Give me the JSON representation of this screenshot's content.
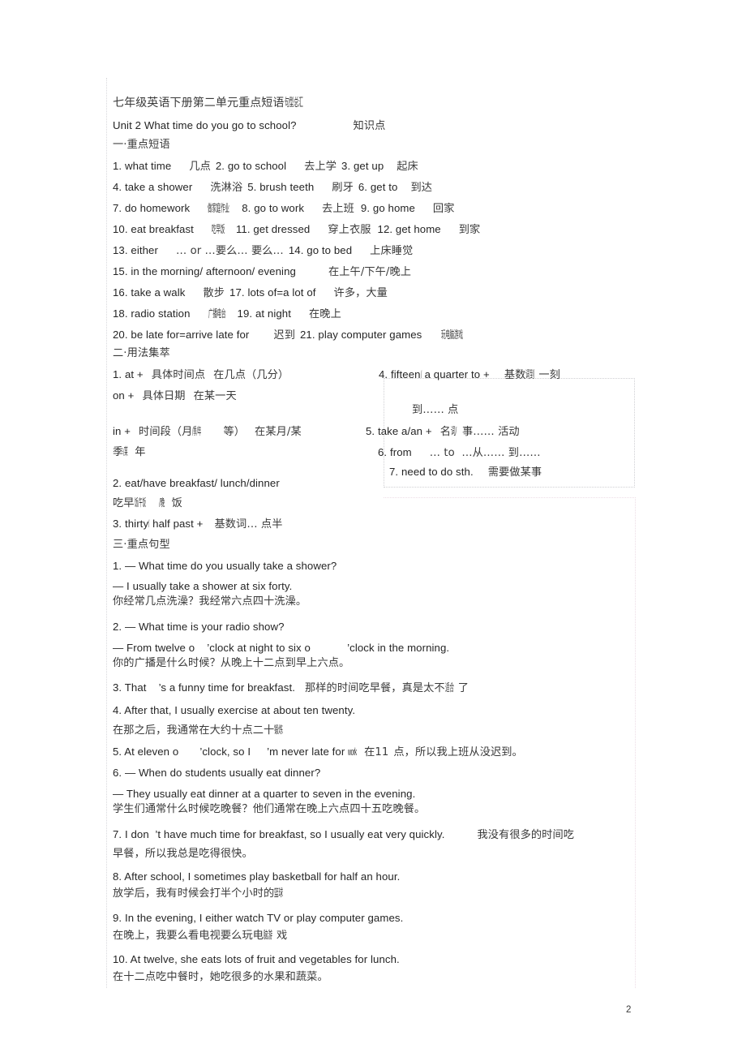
{
  "document": {
    "title": "七年级英语下册第二单元重点短语句型总汇",
    "title_main": "七年级英语下册第二单元重点短语",
    "title_squeezed": "句型总汇",
    "unit_heading": "Unit 2 What time do you go to school?",
    "unit_heading_note": "知识点",
    "page_number": "2"
  },
  "section1": {
    "heading": "一·重点短语",
    "phrases": [
      {
        "line": "1. what time",
        "gloss": "几点",
        "line2": "2. go to school",
        "gloss2": "去上学",
        "line3": "3. get up",
        "gloss3": "起床"
      },
      {
        "line": "4. take a shower",
        "gloss": "洗淋浴",
        "line2": "5. brush teeth",
        "gloss2": "刷牙",
        "line3": "6. get to",
        "gloss3": "到达"
      },
      {
        "line": "7. do homework",
        "gloss": "做家庭作业",
        "line2": "8. go to work",
        "gloss2": "去上班",
        "line3": "9. go home",
        "gloss3": "回家"
      },
      {
        "line": "10. eat breakfast",
        "gloss": "吃早饭",
        "line2": "11. get dressed",
        "gloss2": "穿上衣服",
        "line3": "12. get home",
        "gloss3": "到家"
      },
      {
        "line": "13. either",
        "gloss": "… or …要么… 要么…",
        "line2": "14. go to bed",
        "gloss2": "上床睡觉",
        "line3": "",
        "gloss3": ""
      },
      {
        "line": "15. in the morning/ afternoon/ evening",
        "gloss": "在上午/下午/晚上",
        "line2": "",
        "gloss2": "",
        "line3": "",
        "gloss3": ""
      },
      {
        "line": "16. take a walk",
        "gloss": "散步",
        "line2": "17. lots of=a lot of",
        "gloss2": "许多，大量",
        "line3": "",
        "gloss3": ""
      },
      {
        "line": "18. radio station",
        "gloss": "广播电台",
        "line2": "19. at night",
        "gloss2": "在晚上",
        "line3": "",
        "gloss3": ""
      },
      {
        "line": "20. be late for=arrive late for",
        "gloss": "迟到",
        "line2": "21. play computer games",
        "gloss2": "玩电脑游戏",
        "line3": "",
        "gloss3": ""
      }
    ]
  },
  "section2": {
    "heading": "二·用法集萃",
    "items": [
      {
        "id": "2-1a",
        "text": "1. at +",
        "arg": "具体时间点",
        "gloss": "在几点（几分）"
      },
      {
        "id": "2-1b",
        "text": "on +",
        "arg": "具体日期",
        "gloss": "在某一天"
      },
      {
        "id": "2-1c",
        "text": "in +",
        "arg": "时间段（月/季/年等）",
        "gloss": "在某月/某"
      },
      {
        "id": "2-1d",
        "text": "",
        "arg": "季/某年",
        "gloss": ""
      },
      {
        "id": "2-2a",
        "text": "2. eat/have breakfast/ lunch/dinner",
        "arg": "",
        "gloss": ""
      },
      {
        "id": "2-2b",
        "text": "",
        "arg": "吃早饭/午饭/晚饭",
        "gloss": ""
      },
      {
        "id": "2-3",
        "text": "3. thirty/half past +",
        "arg": "基数词",
        "gloss": "… 点半"
      }
    ],
    "box_items": [
      {
        "id": "2-4",
        "text": "4. fifteen/a quarter to +",
        "gloss": "基数词…一刻"
      },
      {
        "id": "2-4b",
        "text": "",
        "gloss": "到…… 点"
      },
      {
        "id": "2-5",
        "text": "5. take a/an +",
        "gloss": "名词/事…… 活动"
      },
      {
        "id": "2-6",
        "text": "6. from",
        "gloss": "… to  …从…… 到……"
      },
      {
        "id": "2-7",
        "text": "7. need to do sth.",
        "gloss": "需要做某事"
      }
    ]
  },
  "section3": {
    "heading": "三·重点句型",
    "sentences": [
      {
        "q": "1. — What time do you usually take a shower?",
        "a": "— I usually take a shower at six forty.",
        "cn": "你经常几点洗澡？我经常六点四十洗澡。"
      },
      {
        "q": "2. — What time is your radio show?",
        "a": "— From twelve o    ’clock at night to six o            ’clock in the morning.",
        "cn": "你的广播是什么时候？从晚上十二点到早上六点。"
      },
      {
        "q": "3. That    ’s a funny time for breakfast.",
        "a": "",
        "cn": "那样的时间吃早餐，真是太不适合了"
      },
      {
        "q": "4. After that, I usually exercise at about ten twenty.",
        "a": "",
        "cn": "在那之后，我通常在大约十点二十锻炼"
      },
      {
        "q": "5. At eleven o        ’clock, so I        ’m never late for work",
        "a": "",
        "cn": "在11 点，所以我上班从没迟到。"
      },
      {
        "q": "6. — When do students usually eat dinner?",
        "a": "— They usually eat dinner at a quarter to seven in the evening.",
        "cn": "学生们通常什么时候吃晚餐？他们通常在晚上六点四十五吃晚餐。"
      },
      {
        "q": "7. I don  ’t have much time for breakfast, so I usually eat very quickly.",
        "a": "",
        "cn": "我没有很多的时间吃早餐，所以我总是吃得很快。"
      },
      {
        "q": "8. After school, I sometimes play basketball for half an hour.",
        "a": "",
        "cn": "放学后，我有时候会打半个小时的篮球"
      },
      {
        "q": "9. In the evening, I either watch TV or play computer games.",
        "a": "",
        "cn": "在晚上，我要么看电视要么玩电脑游戏"
      },
      {
        "q": "10. At twelve, she eats lots of fruit and vegetables for lunch.",
        "a": "",
        "cn": "在十二点吃中餐时，她吃很多的水果和蔬菜。"
      }
    ]
  }
}
